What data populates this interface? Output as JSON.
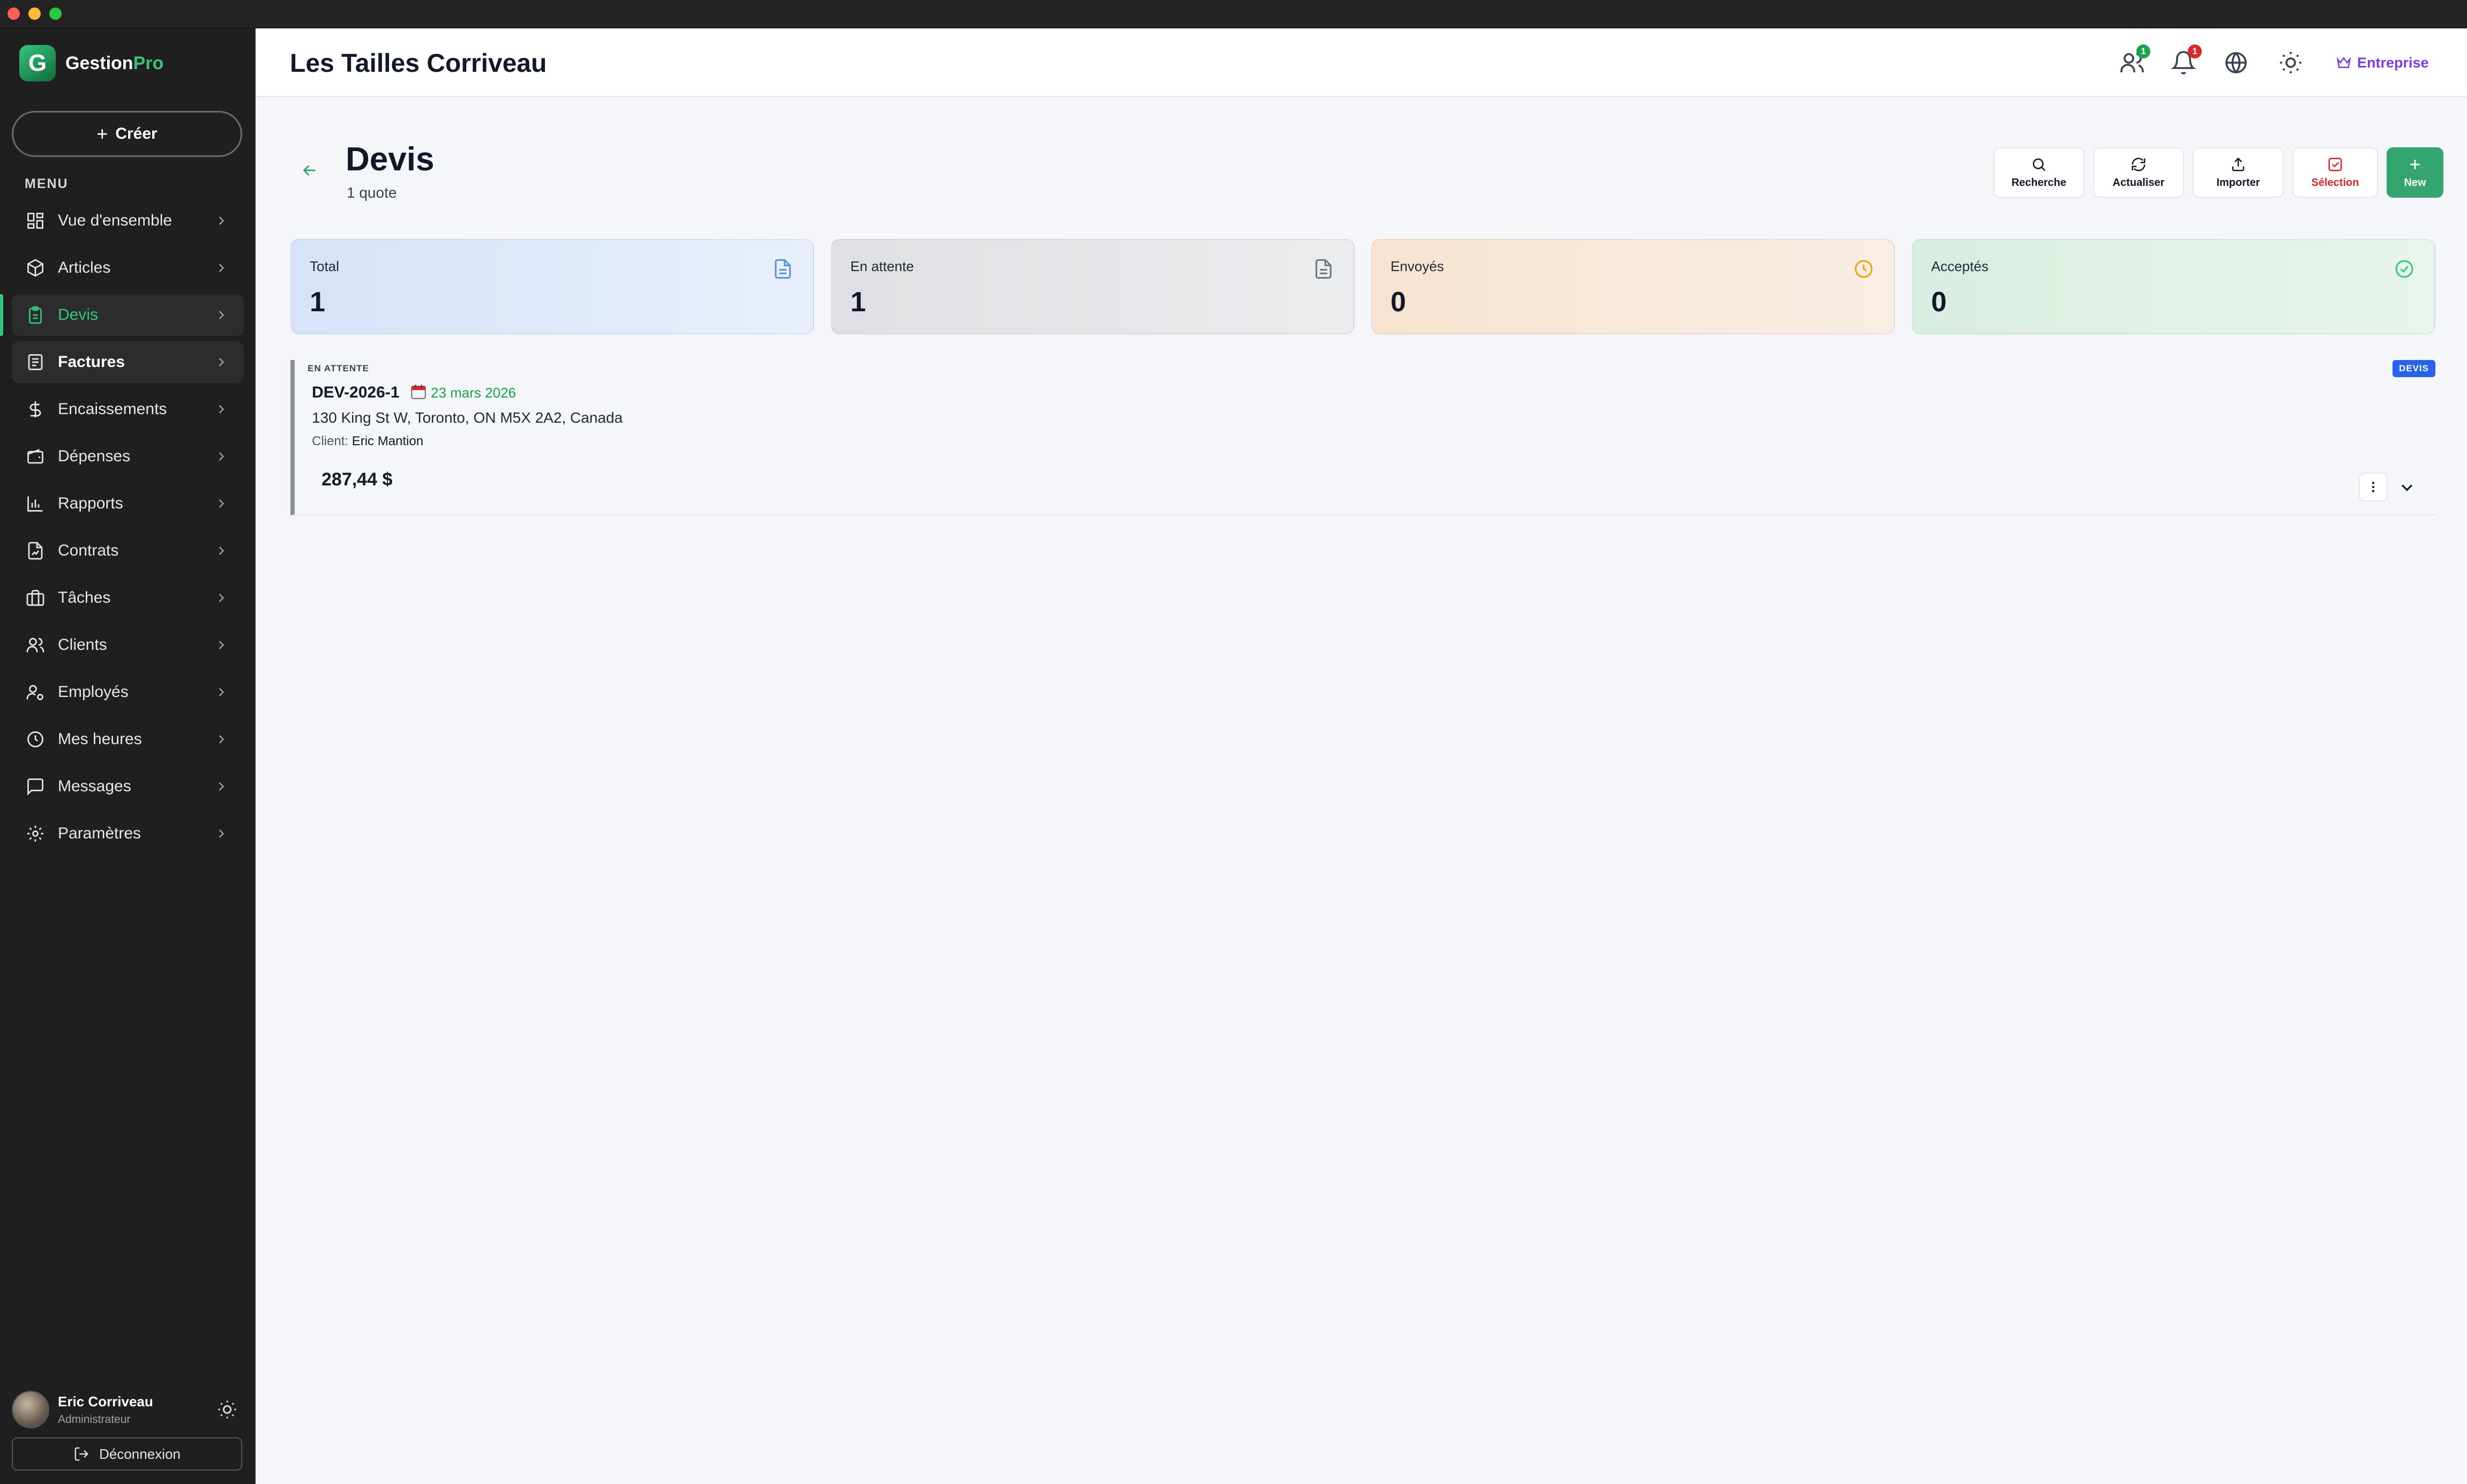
{
  "brand": {
    "name_part1": "Gestion",
    "name_part2": "Pro",
    "logo_letter": "G",
    "accent": "#34c77b"
  },
  "sidebar": {
    "create_label": "Créer",
    "menu_label": "MENU",
    "items": [
      {
        "label": "Vue d'ensemble",
        "icon": "dashboard-icon"
      },
      {
        "label": "Articles",
        "icon": "package-icon"
      },
      {
        "label": "Devis",
        "icon": "clipboard-icon",
        "active": true
      },
      {
        "label": "Factures",
        "icon": "invoice-icon",
        "hovered": true
      },
      {
        "label": "Encaissements",
        "icon": "dollar-icon"
      },
      {
        "label": "Dépenses",
        "icon": "wallet-icon"
      },
      {
        "label": "Rapports",
        "icon": "bar-chart-icon"
      },
      {
        "label": "Contrats",
        "icon": "contract-icon"
      },
      {
        "label": "Tâches",
        "icon": "briefcase-icon"
      },
      {
        "label": "Clients",
        "icon": "users-icon"
      },
      {
        "label": "Employés",
        "icon": "user-cog-icon"
      },
      {
        "label": "Mes heures",
        "icon": "clock-icon"
      },
      {
        "label": "Messages",
        "icon": "message-icon"
      },
      {
        "label": "Paramètres",
        "icon": "settings-icon"
      }
    ],
    "user": {
      "name": "Eric Corriveau",
      "role": "Administrateur"
    },
    "logout_label": "Déconnexion"
  },
  "header": {
    "company": "Les Tailles Corriveau",
    "team_badge": "1",
    "notif_badge": "1",
    "plan_label": "Entreprise"
  },
  "page": {
    "title": "Devis",
    "subtitle": "1 quote",
    "toolbar": {
      "search": "Recherche",
      "refresh": "Actualiser",
      "import": "Importer",
      "select": "Sélection",
      "new": "New"
    }
  },
  "stats": [
    {
      "label": "Total",
      "value": "1",
      "icon": "document-icon",
      "color": "#5b8fd9"
    },
    {
      "label": "En attente",
      "value": "1",
      "icon": "document-icon",
      "color": "#6b7280"
    },
    {
      "label": "Envoyés",
      "value": "0",
      "icon": "clock-icon",
      "color": "#f59e0b"
    },
    {
      "label": "Acceptés",
      "value": "0",
      "icon": "check-circle-icon",
      "color": "#34c77b"
    }
  ],
  "quotes": [
    {
      "status": "EN ATTENTE",
      "type_badge": "DEVIS",
      "number": "DEV-2026-1",
      "date": "23 mars 2026",
      "address": "130 King St W, Toronto, ON M5X 2A2, Canada",
      "client_label": "Client:",
      "client_name": "Eric Mantion",
      "amount": "287,44 $"
    }
  ]
}
